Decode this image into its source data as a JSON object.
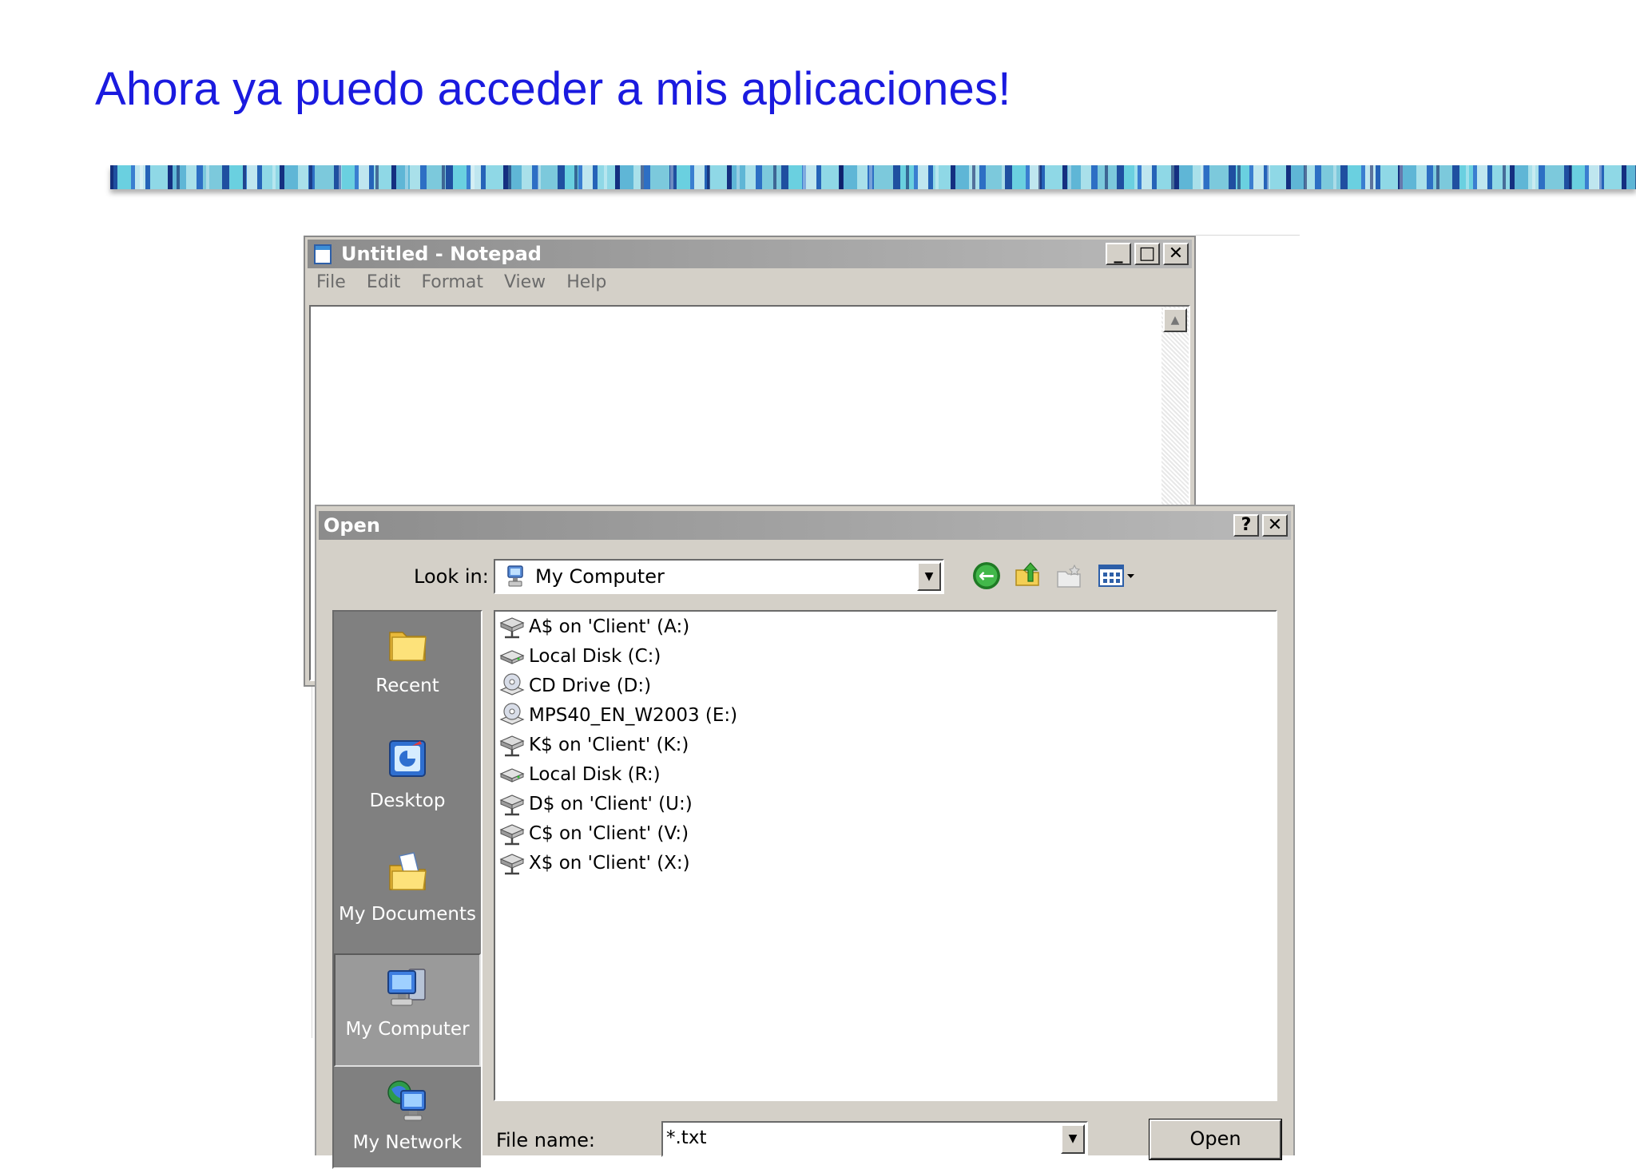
{
  "slide": {
    "title": "Ahora ya puedo acceder a mis aplicaciones!"
  },
  "notepad": {
    "title": "Untitled - Notepad",
    "menu": [
      "File",
      "Edit",
      "Format",
      "View",
      "Help"
    ],
    "caption_buttons": {
      "minimize": "_",
      "maximize": "□",
      "close": "✕"
    }
  },
  "open_dialog": {
    "title": "Open",
    "caption_buttons": {
      "help": "?",
      "close": "✕"
    },
    "look_in_label": "Look in:",
    "look_in_value": "My Computer",
    "toolbar_icons": [
      "back-icon",
      "up-folder-icon",
      "new-folder-icon",
      "views-menu-icon"
    ],
    "places": [
      {
        "label": "Recent",
        "icon": "recent-folder-icon"
      },
      {
        "label": "Desktop",
        "icon": "desktop-icon"
      },
      {
        "label": "My Documents",
        "icon": "my-documents-icon"
      },
      {
        "label": "My Computer",
        "icon": "my-computer-icon",
        "selected": true
      },
      {
        "label": "My Network",
        "icon": "my-network-icon"
      }
    ],
    "files": [
      {
        "label": "A$ on 'Client' (A:)",
        "icon": "network-drive-icon"
      },
      {
        "label": "Local Disk (C:)",
        "icon": "local-disk-icon"
      },
      {
        "label": "CD Drive (D:)",
        "icon": "cd-drive-icon"
      },
      {
        "label": "MPS40_EN_W2003 (E:)",
        "icon": "cd-drive-icon"
      },
      {
        "label": "K$ on 'Client' (K:)",
        "icon": "network-drive-icon"
      },
      {
        "label": "Local Disk (R:)",
        "icon": "local-disk-icon"
      },
      {
        "label": "D$ on 'Client' (U:)",
        "icon": "network-drive-icon"
      },
      {
        "label": "C$ on 'Client' (V:)",
        "icon": "network-drive-icon"
      },
      {
        "label": "X$ on 'Client' (X:)",
        "icon": "network-drive-icon"
      }
    ],
    "file_name_label": "File name:",
    "file_name_value": "*.txt",
    "open_button": "Open"
  }
}
